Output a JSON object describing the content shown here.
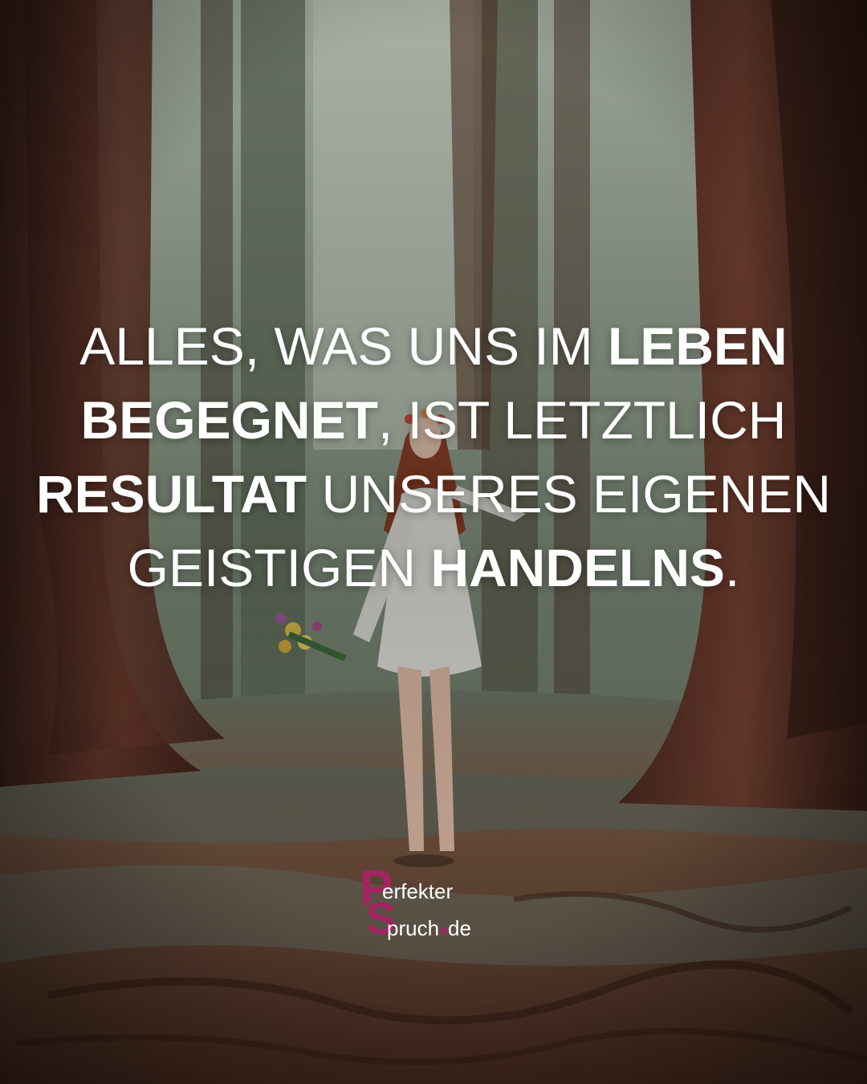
{
  "quote": {
    "line1": [
      {
        "text": "ALLES, WAS UNS IM ",
        "bold": false
      },
      {
        "text": "LEBEN",
        "bold": true
      }
    ],
    "line2": [
      {
        "text": "BEGEGNET",
        "bold": true
      },
      {
        "text": ", IST LETZTLICH",
        "bold": false
      }
    ],
    "line3": [
      {
        "text": "RESULTAT",
        "bold": true
      },
      {
        "text": " UNSERES EIGENEN",
        "bold": false
      }
    ],
    "line4": [
      {
        "text": "GEISTIGEN ",
        "bold": false
      },
      {
        "text": "HANDELNS",
        "bold": true
      },
      {
        "text": ".",
        "bold": false
      }
    ]
  },
  "logo": {
    "letter_p": "P",
    "letter_s": "S",
    "word_top": "erfekter",
    "word_bottom_a": "pruch",
    "word_bottom_b": "de",
    "brand_color": "#a3245e"
  },
  "scene": {
    "icon": "forest-photo-woman-walking-icon"
  }
}
